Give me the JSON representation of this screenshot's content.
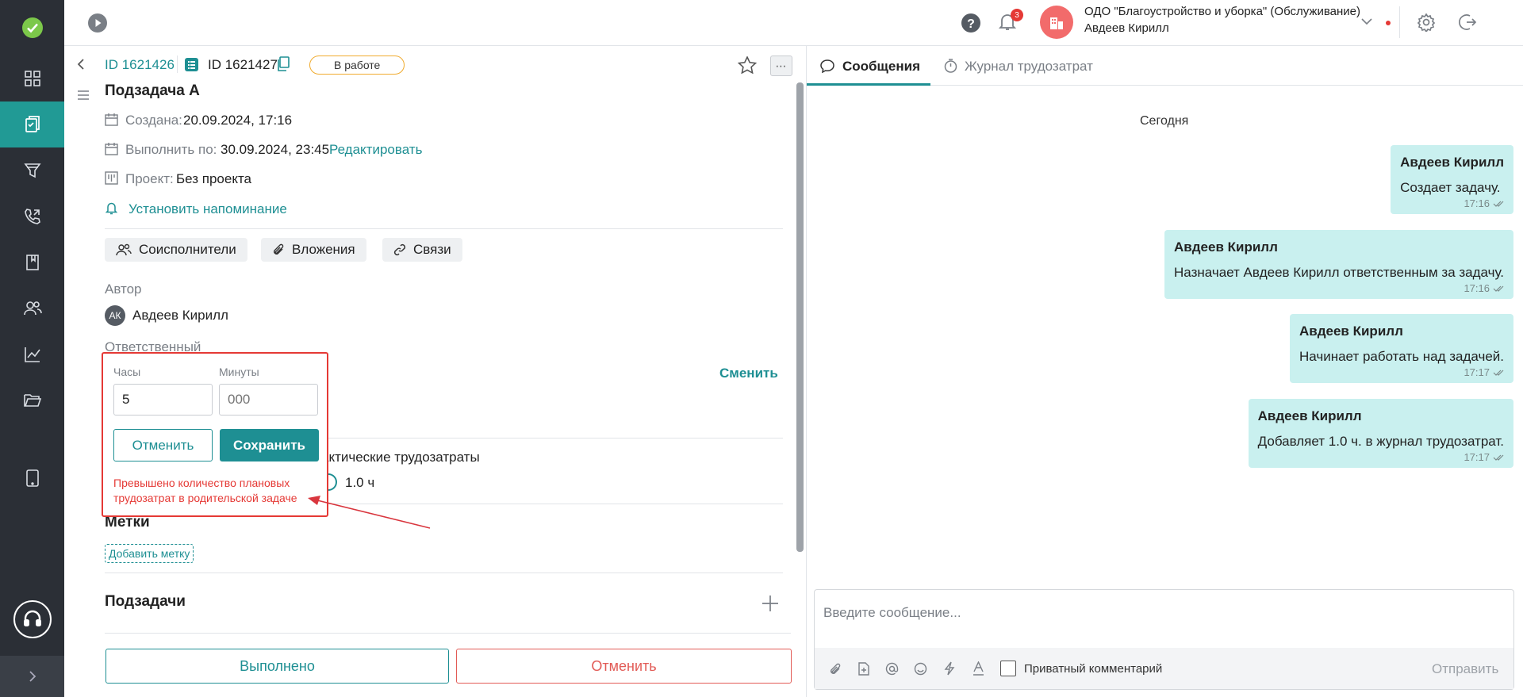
{
  "topbar": {
    "notif_count": "3",
    "org_name": "ОДО \"Благоустройство и уборка\" (Обслуживание)",
    "user_name": "Авдеев Кирилл"
  },
  "task": {
    "parent_id": "ID 1621426",
    "id": "ID 1621427",
    "status": "В работе",
    "title": "Подзадача А",
    "created_label": "Создана:",
    "created_value": "20.09.2024, 17:16",
    "due_label": "Выполнить по:",
    "due_value": "30.09.2024, 23:45",
    "edit_link": "Редактировать",
    "project_label": "Проект:",
    "project_value": "Без проекта",
    "reminder_link": "Установить напоминание",
    "chips": {
      "coexecutors": "Соисполнители",
      "attachments": "Вложения",
      "links": "Связи"
    },
    "author_label": "Автор",
    "author_initials": "АК",
    "author_name": "Авдеев Кирилл",
    "responsible_label": "Ответственный",
    "change_link": "Сменить",
    "actual_label": "актические трудозатраты",
    "actual_value": "1.0 ч",
    "tags_title": "Метки",
    "add_tag": "Добавить метку",
    "subtasks_title": "Подзадачи",
    "done_button": "Выполнено",
    "cancel_button": "Отменить"
  },
  "popup": {
    "hours_label": "Часы",
    "hours_value": "5",
    "minutes_label": "Минуты",
    "minutes_placeholder": "000",
    "cancel": "Отменить",
    "save": "Сохранить",
    "error": "Превышено количество плановых трудозатрат в родительской задаче"
  },
  "chat": {
    "tab_messages": "Сообщения",
    "tab_journal": "Журнал трудозатрат",
    "day": "Сегодня",
    "messages": [
      {
        "author": "Авдеев Кирилл",
        "text": "Создает задачу.",
        "time": "17:16"
      },
      {
        "author": "Авдеев Кирилл",
        "text": "Назначает Авдеев Кирилл ответственным за задачу.",
        "time": "17:16"
      },
      {
        "author": "Авдеев Кирилл",
        "text": "Начинает работать над задачей.",
        "time": "17:17"
      },
      {
        "author": "Авдеев Кирилл",
        "text": "Добавляет 1.0 ч. в журнал трудозатрат.",
        "time": "17:17"
      }
    ],
    "input_placeholder": "Введите сообщение...",
    "private_label": "Приватный комментарий",
    "send": "Отправить"
  },
  "colors": {
    "accent": "#1e8f93",
    "sidebar": "#2b2f36",
    "error": "#e53935",
    "bubble": "#c9f0ef"
  }
}
